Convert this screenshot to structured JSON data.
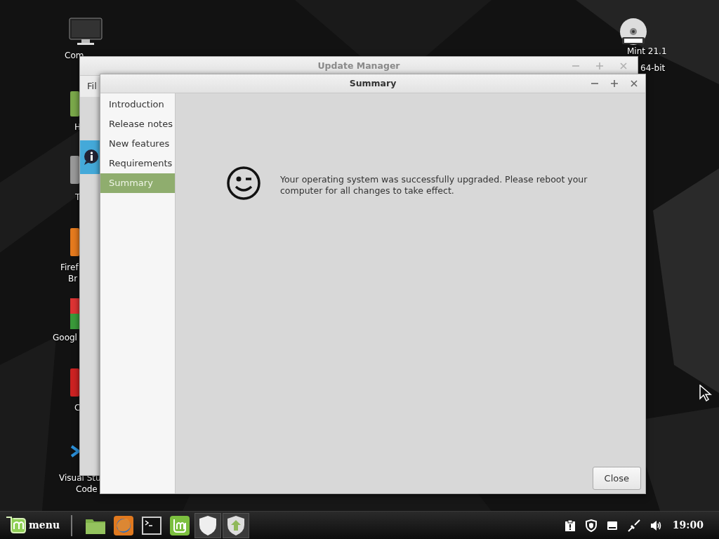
{
  "desktop_icons": [
    {
      "kind": "computer",
      "lines": [
        "Com"
      ]
    },
    {
      "kind": "home",
      "lines": [
        "H"
      ]
    },
    {
      "kind": "trash",
      "lines": [
        "T"
      ]
    },
    {
      "kind": "firefox",
      "lines": [
        "Firef",
        "Br"
      ]
    },
    {
      "kind": "chrome",
      "lines": [
        "Googl"
      ]
    },
    {
      "kind": "red",
      "lines": [
        "C"
      ]
    },
    {
      "kind": "vscode",
      "lines": [
        "Visual Stu",
        "Code"
      ]
    },
    {
      "kind": "dvd",
      "lines": [
        "Mint 21.1",
        "64-bit"
      ]
    }
  ],
  "back_window": {
    "title": "Update Manager",
    "menu": [
      "Fil"
    ]
  },
  "dialog": {
    "title": "Summary",
    "sidebar": [
      {
        "label": "Introduction",
        "selected": false
      },
      {
        "label": "Release notes",
        "selected": false
      },
      {
        "label": "New features",
        "selected": false
      },
      {
        "label": "Requirements",
        "selected": false
      },
      {
        "label": "Summary",
        "selected": true
      }
    ],
    "message": "Your operating system was successfully upgraded. Please reboot your computer for all changes to take effect.",
    "button": "Close"
  },
  "taskbar": {
    "menu_label": "menu",
    "launchers": [
      {
        "kind": "folder",
        "open": false
      },
      {
        "kind": "firefox",
        "open": false
      },
      {
        "kind": "terminal",
        "open": false
      },
      {
        "kind": "mint",
        "open": false
      },
      {
        "kind": "shield",
        "open": true
      },
      {
        "kind": "update",
        "open": true
      }
    ],
    "tray": [
      {
        "kind": "notes"
      },
      {
        "kind": "shield"
      },
      {
        "kind": "display"
      },
      {
        "kind": "network"
      },
      {
        "kind": "volume"
      }
    ],
    "clock": "19:00"
  }
}
